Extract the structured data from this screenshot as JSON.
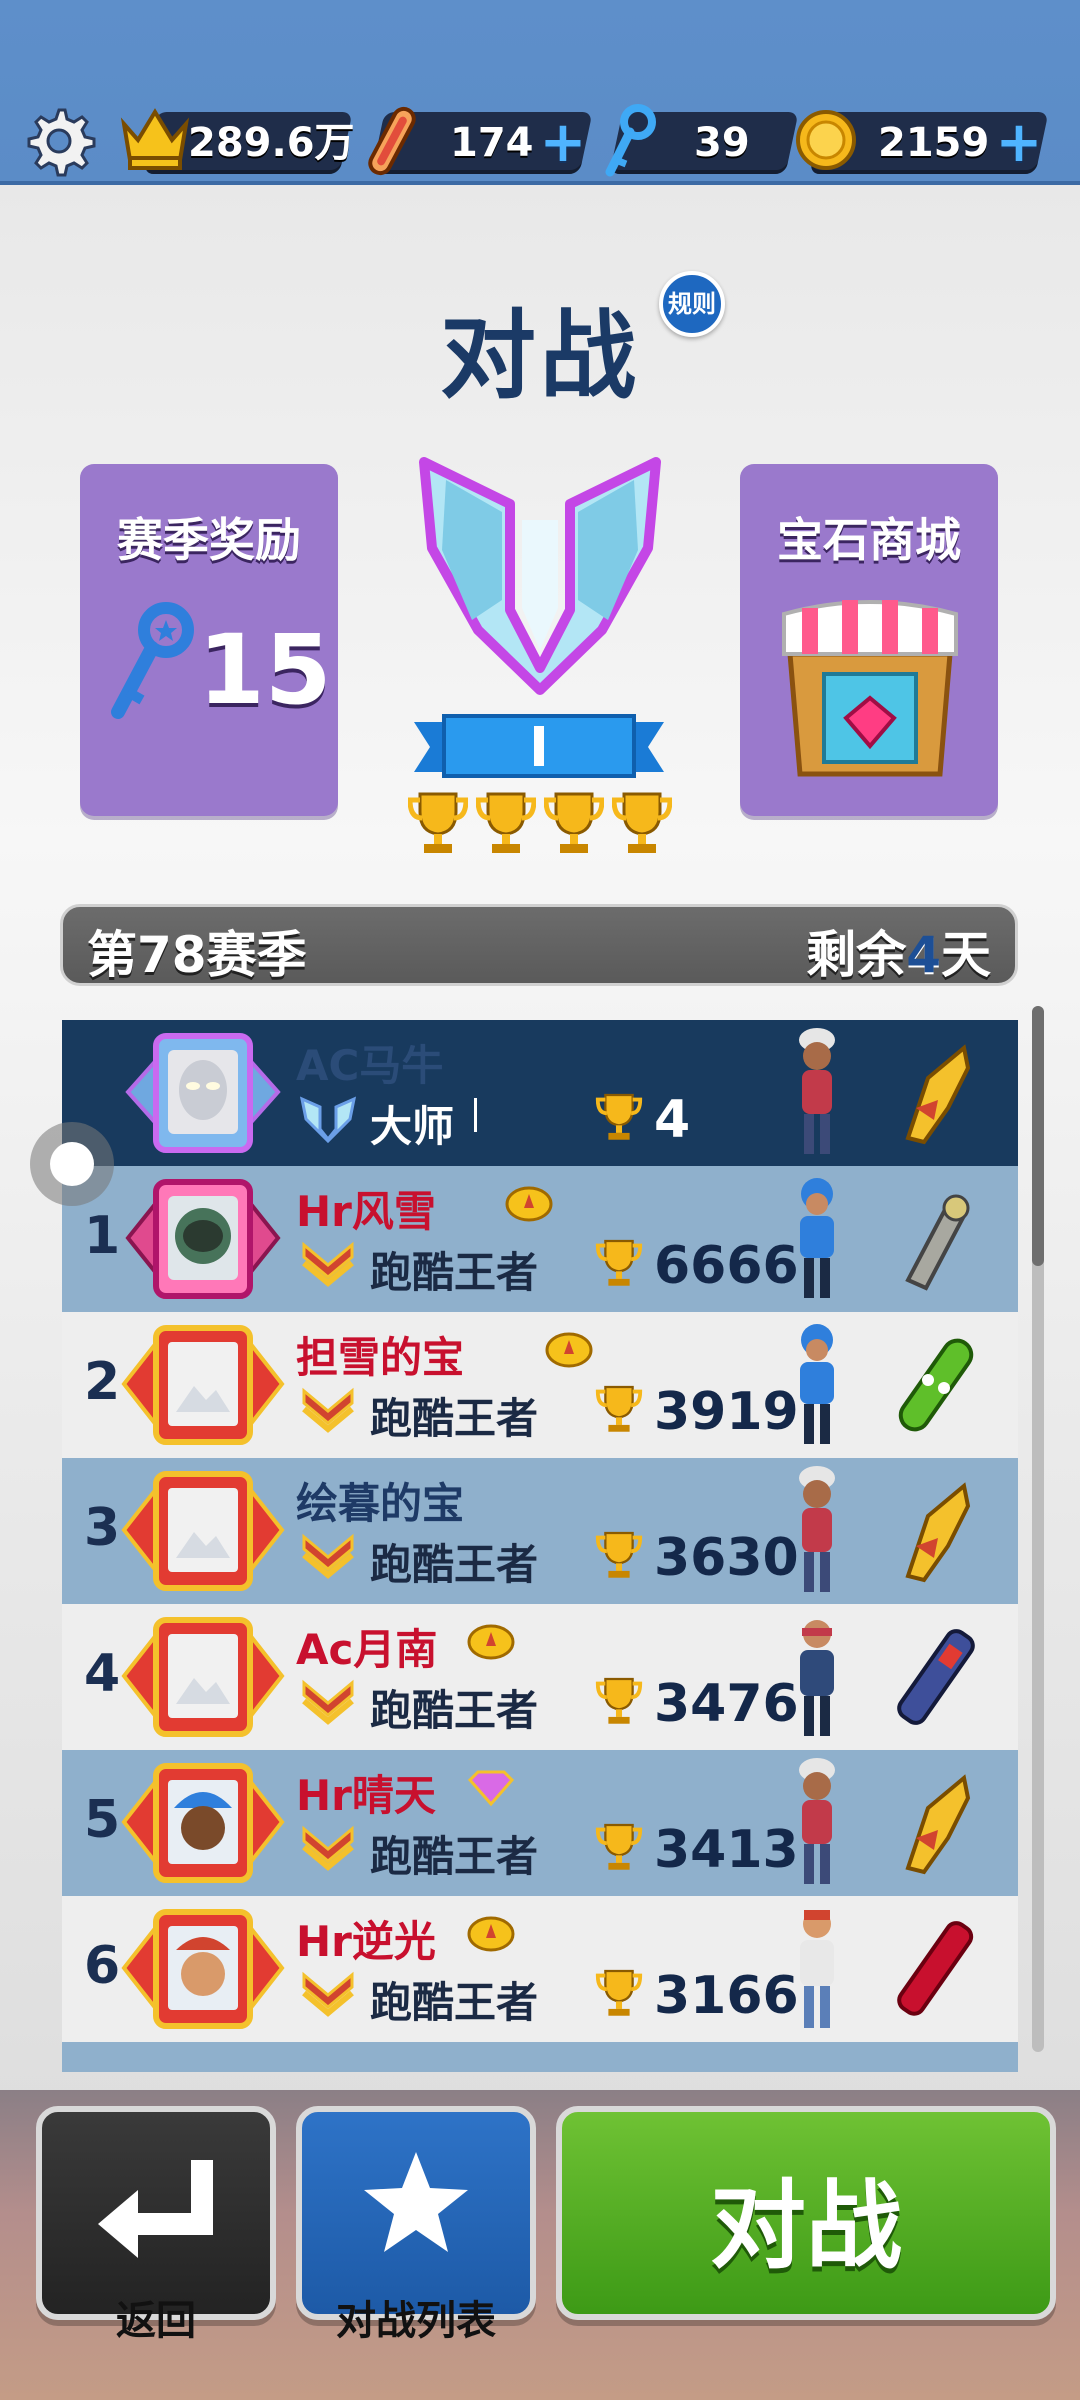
{
  "topbar": {
    "crowns": "289.6万",
    "boards": "174",
    "keys": "39",
    "coins": "2159"
  },
  "header": {
    "title": "对战",
    "rules_label": "规则"
  },
  "panels": {
    "season_reward": {
      "title": "赛季奖励",
      "count": "15"
    },
    "gem_shop": {
      "title": "宝石商城"
    }
  },
  "league": {
    "division": "I",
    "trophies_earned": 4
  },
  "season": {
    "name": "第78赛季",
    "remaining_prefix": "剩余",
    "remaining_days": "4",
    "remaining_suffix": "天"
  },
  "leaderboard": {
    "me": {
      "name": "AC马牛",
      "rank_title": "大师",
      "score": "4"
    },
    "rows": [
      {
        "rank": "1",
        "name": "Hr风雪",
        "rank_title": "跑酷王者",
        "score": "6666"
      },
      {
        "rank": "2",
        "name": "担雪的宝",
        "rank_title": "跑酷王者",
        "score": "3919"
      },
      {
        "rank": "3",
        "name": "绘暮的宝",
        "rank_title": "跑酷王者",
        "score": "3630"
      },
      {
        "rank": "4",
        "name": "Ac月南",
        "rank_title": "跑酷王者",
        "score": "3476"
      },
      {
        "rank": "5",
        "name": "Hr晴天",
        "rank_title": "跑酷王者",
        "score": "3413"
      },
      {
        "rank": "6",
        "name": "Hr逆光",
        "rank_title": "跑酷王者",
        "score": "3166"
      }
    ]
  },
  "bottom": {
    "back_label": "返回",
    "list_label": "对战列表",
    "battle_label": "对战"
  },
  "colors": {
    "topbar": "#5e8fca",
    "panel": "#9a79cc",
    "row_me": "#183a5e",
    "row_blue": "#8fb0cc",
    "row_light": "#eeeeee",
    "name_red": "#c8102e",
    "battle_green": "#4fa91e"
  }
}
